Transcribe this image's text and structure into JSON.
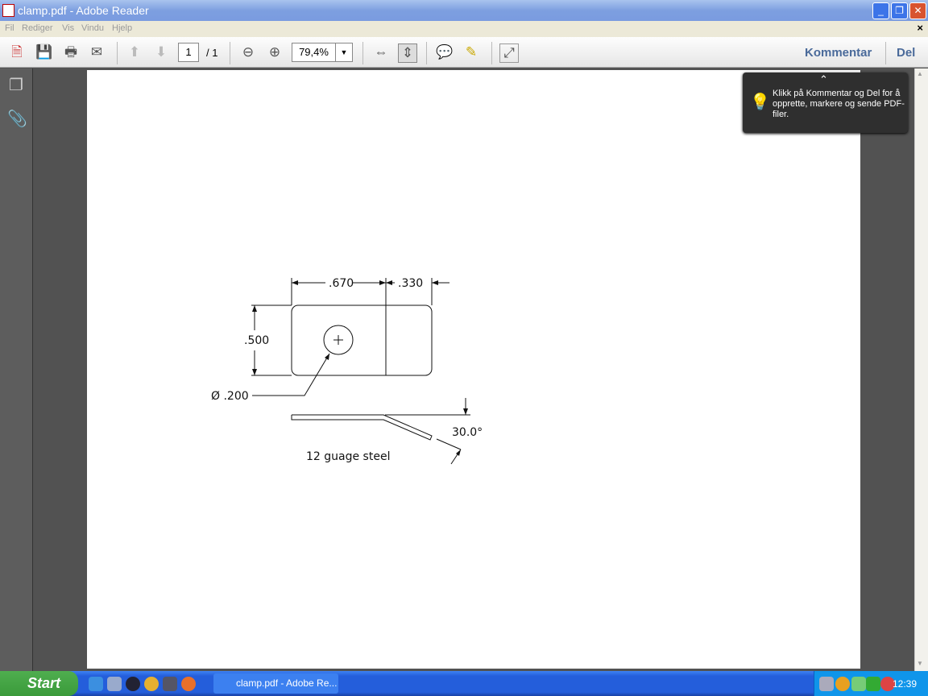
{
  "window": {
    "title": "clamp.pdf - Adobe Reader"
  },
  "menu": [
    "Fil",
    "Rediger",
    "Vis",
    "Vindu",
    "Hjelp"
  ],
  "toolbar": {
    "page_current": "1",
    "page_total": "/ 1",
    "zoom": "79,4%",
    "kommentar": "Kommentar",
    "del": "Del"
  },
  "tooltip": {
    "text": "Klikk på Kommentar og Del for å opprette, markere og sende PDF-filer."
  },
  "drawing": {
    "dim_width": ".670",
    "dim_tab": ".330",
    "dim_height": ".500",
    "hole": "Ø .200",
    "angle": "30.0°",
    "material": "12 guage steel"
  },
  "taskbar": {
    "start": "Start",
    "task": "clamp.pdf - Adobe Re...",
    "clock": "12:39"
  }
}
